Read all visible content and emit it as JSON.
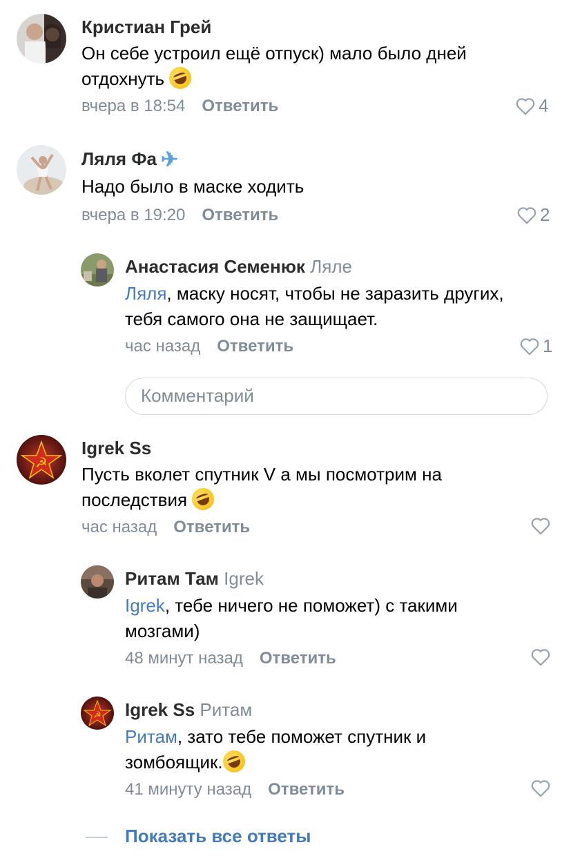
{
  "comments": [
    {
      "author": "Кристиан Грей",
      "text_line1": "Он себе устроил ещё отпуск) мало было дней",
      "text_line2": "отдохнуть",
      "time": "вчера в 18:54",
      "reply_label": "Ответить",
      "likes": "4",
      "emoji": "rofl-emoji"
    },
    {
      "author": "Ляля Фа",
      "author_icon": "airplane-icon",
      "text": "Надо было в маске ходить",
      "time": "вчера в 19:20",
      "reply_label": "Ответить",
      "likes": "2",
      "replies": [
        {
          "author": "Анастасия Семенюк",
          "reply_to": "Ляле",
          "mention": "Ляля",
          "text_line1": ", маску носят, чтобы не заразить других,",
          "text_line2": "тебя самого она не защищает.",
          "time": "час назад",
          "reply_label": "Ответить",
          "likes": "1"
        }
      ]
    },
    {
      "author": "Igrek Ss",
      "text_line1": "Пусть вколет спутник V а мы посмотрим на",
      "text_line2": "последствия",
      "time": "час назад",
      "reply_label": "Ответить",
      "likes": "",
      "emoji": "rofl-emoji",
      "replies": [
        {
          "author": "Ритам Там",
          "reply_to": "Igrek",
          "mention": "Igrek",
          "text_line1": ", тебе ничего не поможет) с такими",
          "text_line2": "мозгами)",
          "time": "48 минут назад",
          "reply_label": "Ответить",
          "likes": ""
        },
        {
          "author": "Igrek Ss",
          "reply_to": "Ритам",
          "mention": "Ритам",
          "text_line1": ", зато тебе поможет спутник и",
          "text_line2": "зомбоящик.",
          "time": "41 минуту назад",
          "reply_label": "Ответить",
          "likes": "",
          "emoji": "rofl-emoji"
        }
      ]
    }
  ],
  "comment_input": {
    "placeholder": "Комментарий"
  },
  "show_all_replies": "Показать все ответы",
  "colors": {
    "secondary": "#818c99",
    "link": "#447bba",
    "author": "#2c2d2e"
  }
}
